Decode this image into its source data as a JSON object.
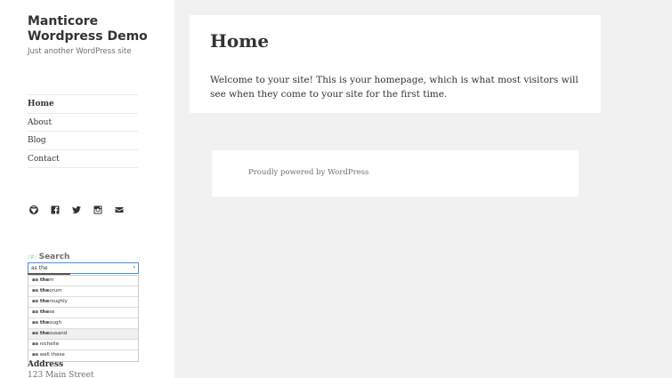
{
  "site": {
    "title": "Manticore Wordpress Demo",
    "description": "Just another WordPress site"
  },
  "nav": {
    "items": [
      {
        "label": "Home",
        "current": true
      },
      {
        "label": "About"
      },
      {
        "label": "Blog"
      },
      {
        "label": "Contact"
      }
    ]
  },
  "social": {
    "icons": [
      "wordpress-icon",
      "facebook-icon",
      "twitter-icon",
      "instagram-icon",
      "email-icon"
    ]
  },
  "search": {
    "badge": "/#/",
    "label": "Search",
    "value": "as the",
    "suggestions": [
      {
        "bold": "as the",
        "rest": "m"
      },
      {
        "bold": "as the",
        "rest": "orum"
      },
      {
        "bold": "as the",
        "rest": "roughly"
      },
      {
        "bold": "as the",
        "rest": "se"
      },
      {
        "bold": "as the",
        "rest": "ough"
      },
      {
        "bold": "as the",
        "rest": "ousand"
      },
      {
        "bold": "as",
        "rest": " nichelle"
      },
      {
        "bold": "as",
        "rest": " well these"
      }
    ]
  },
  "address": {
    "title": "Address",
    "line1": "123 Main Street"
  },
  "page": {
    "title": "Home",
    "text": "Welcome to your site! This is your homepage, which is what most visitors will see when they come to your site for the first time."
  },
  "footer": {
    "text": "Proudly powered by WordPress"
  }
}
